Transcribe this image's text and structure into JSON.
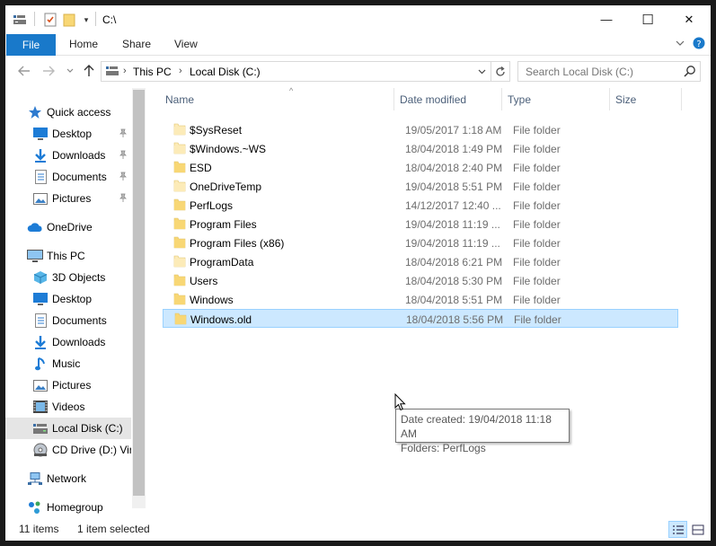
{
  "window": {
    "title": "C:\\",
    "controls": {
      "minimize": "—",
      "maximize": "☐",
      "close": "✕"
    }
  },
  "ribbon": {
    "file_tab": "File",
    "tabs": [
      "Home",
      "Share",
      "View"
    ],
    "expand_icon": "chevron-down-icon",
    "help_icon": "help-icon"
  },
  "address_bar": {
    "crumbs": [
      "This PC",
      "Local Disk (C:)"
    ]
  },
  "search": {
    "placeholder": "Search Local Disk (C:)"
  },
  "nav_pane": {
    "quick_access": {
      "label": "Quick access",
      "items": [
        {
          "label": "Desktop",
          "icon": "desktop-icon",
          "pinned": true
        },
        {
          "label": "Downloads",
          "icon": "downloads-icon",
          "pinned": true
        },
        {
          "label": "Documents",
          "icon": "documents-icon",
          "pinned": true
        },
        {
          "label": "Pictures",
          "icon": "pictures-icon",
          "pinned": true
        }
      ]
    },
    "onedrive": {
      "label": "OneDrive"
    },
    "this_pc": {
      "label": "This PC",
      "items": [
        {
          "label": "3D Objects",
          "icon": "3d-objects-icon"
        },
        {
          "label": "Desktop",
          "icon": "desktop-icon"
        },
        {
          "label": "Documents",
          "icon": "documents-icon"
        },
        {
          "label": "Downloads",
          "icon": "downloads-icon"
        },
        {
          "label": "Music",
          "icon": "music-icon"
        },
        {
          "label": "Pictures",
          "icon": "pictures-icon"
        },
        {
          "label": "Videos",
          "icon": "videos-icon"
        },
        {
          "label": "Local Disk (C:)",
          "icon": "local-disk-icon",
          "selected": true
        },
        {
          "label": "CD Drive (D:) Vir",
          "icon": "cd-drive-icon"
        }
      ]
    },
    "network": {
      "label": "Network"
    },
    "homegroup": {
      "label": "Homegroup"
    }
  },
  "file_list": {
    "columns": [
      "Name",
      "Date modified",
      "Type",
      "Size"
    ],
    "rows": [
      {
        "name": "$SysReset",
        "date": "19/05/2017 1:18 AM",
        "type": "File folder",
        "faded": true
      },
      {
        "name": "$Windows.~WS",
        "date": "18/04/2018 1:49 PM",
        "type": "File folder",
        "faded": true
      },
      {
        "name": "ESD",
        "date": "18/04/2018 2:40 PM",
        "type": "File folder",
        "faded": false
      },
      {
        "name": "OneDriveTemp",
        "date": "19/04/2018 5:51 PM",
        "type": "File folder",
        "faded": true
      },
      {
        "name": "PerfLogs",
        "date": "14/12/2017 12:40 ...",
        "type": "File folder",
        "faded": false
      },
      {
        "name": "Program Files",
        "date": "19/04/2018 11:19 ...",
        "type": "File folder",
        "faded": false
      },
      {
        "name": "Program Files (x86)",
        "date": "19/04/2018 11:19 ...",
        "type": "File folder",
        "faded": false
      },
      {
        "name": "ProgramData",
        "date": "18/04/2018 6:21 PM",
        "type": "File folder",
        "faded": true
      },
      {
        "name": "Users",
        "date": "18/04/2018 5:30 PM",
        "type": "File folder",
        "faded": false
      },
      {
        "name": "Windows",
        "date": "18/04/2018 5:51 PM",
        "type": "File folder",
        "faded": false
      },
      {
        "name": "Windows.old",
        "date": "18/04/2018 5:56 PM",
        "type": "File folder",
        "faded": false,
        "selected": true
      }
    ]
  },
  "tooltip": {
    "line1": "Date created: 19/04/2018 11:18 AM",
    "line2": "Folders: PerfLogs"
  },
  "status_bar": {
    "item_count": "11 items",
    "selection": "1 item selected"
  },
  "colors": {
    "accent": "#1979ca",
    "selection_bg": "#cce8ff",
    "selection_border": "#99d1ff",
    "folder": "#f8d775",
    "folder_faded": "#fcebb8"
  }
}
